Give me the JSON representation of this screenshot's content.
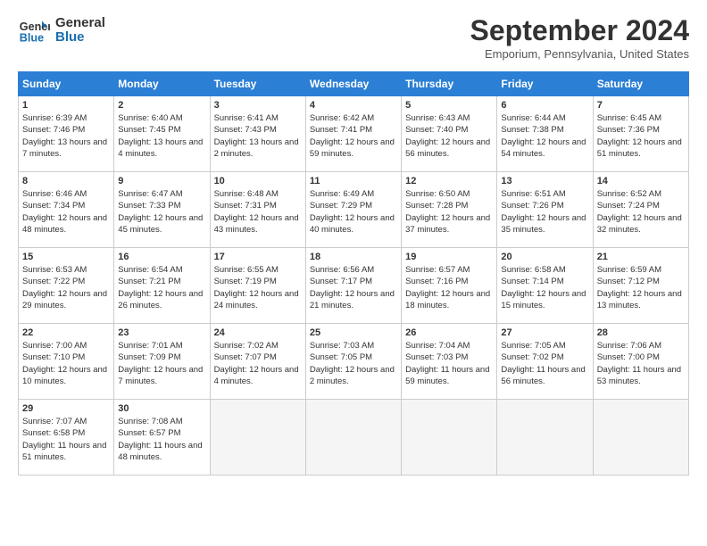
{
  "logo": {
    "line1": "General",
    "line2": "Blue"
  },
  "title": "September 2024",
  "location": "Emporium, Pennsylvania, United States",
  "headers": [
    "Sunday",
    "Monday",
    "Tuesday",
    "Wednesday",
    "Thursday",
    "Friday",
    "Saturday"
  ],
  "weeks": [
    [
      {
        "day": "1",
        "rise": "Sunrise: 6:39 AM",
        "set": "Sunset: 7:46 PM",
        "daylight": "Daylight: 13 hours and 7 minutes."
      },
      {
        "day": "2",
        "rise": "Sunrise: 6:40 AM",
        "set": "Sunset: 7:45 PM",
        "daylight": "Daylight: 13 hours and 4 minutes."
      },
      {
        "day": "3",
        "rise": "Sunrise: 6:41 AM",
        "set": "Sunset: 7:43 PM",
        "daylight": "Daylight: 13 hours and 2 minutes."
      },
      {
        "day": "4",
        "rise": "Sunrise: 6:42 AM",
        "set": "Sunset: 7:41 PM",
        "daylight": "Daylight: 12 hours and 59 minutes."
      },
      {
        "day": "5",
        "rise": "Sunrise: 6:43 AM",
        "set": "Sunset: 7:40 PM",
        "daylight": "Daylight: 12 hours and 56 minutes."
      },
      {
        "day": "6",
        "rise": "Sunrise: 6:44 AM",
        "set": "Sunset: 7:38 PM",
        "daylight": "Daylight: 12 hours and 54 minutes."
      },
      {
        "day": "7",
        "rise": "Sunrise: 6:45 AM",
        "set": "Sunset: 7:36 PM",
        "daylight": "Daylight: 12 hours and 51 minutes."
      }
    ],
    [
      {
        "day": "8",
        "rise": "Sunrise: 6:46 AM",
        "set": "Sunset: 7:34 PM",
        "daylight": "Daylight: 12 hours and 48 minutes."
      },
      {
        "day": "9",
        "rise": "Sunrise: 6:47 AM",
        "set": "Sunset: 7:33 PM",
        "daylight": "Daylight: 12 hours and 45 minutes."
      },
      {
        "day": "10",
        "rise": "Sunrise: 6:48 AM",
        "set": "Sunset: 7:31 PM",
        "daylight": "Daylight: 12 hours and 43 minutes."
      },
      {
        "day": "11",
        "rise": "Sunrise: 6:49 AM",
        "set": "Sunset: 7:29 PM",
        "daylight": "Daylight: 12 hours and 40 minutes."
      },
      {
        "day": "12",
        "rise": "Sunrise: 6:50 AM",
        "set": "Sunset: 7:28 PM",
        "daylight": "Daylight: 12 hours and 37 minutes."
      },
      {
        "day": "13",
        "rise": "Sunrise: 6:51 AM",
        "set": "Sunset: 7:26 PM",
        "daylight": "Daylight: 12 hours and 35 minutes."
      },
      {
        "day": "14",
        "rise": "Sunrise: 6:52 AM",
        "set": "Sunset: 7:24 PM",
        "daylight": "Daylight: 12 hours and 32 minutes."
      }
    ],
    [
      {
        "day": "15",
        "rise": "Sunrise: 6:53 AM",
        "set": "Sunset: 7:22 PM",
        "daylight": "Daylight: 12 hours and 29 minutes."
      },
      {
        "day": "16",
        "rise": "Sunrise: 6:54 AM",
        "set": "Sunset: 7:21 PM",
        "daylight": "Daylight: 12 hours and 26 minutes."
      },
      {
        "day": "17",
        "rise": "Sunrise: 6:55 AM",
        "set": "Sunset: 7:19 PM",
        "daylight": "Daylight: 12 hours and 24 minutes."
      },
      {
        "day": "18",
        "rise": "Sunrise: 6:56 AM",
        "set": "Sunset: 7:17 PM",
        "daylight": "Daylight: 12 hours and 21 minutes."
      },
      {
        "day": "19",
        "rise": "Sunrise: 6:57 AM",
        "set": "Sunset: 7:16 PM",
        "daylight": "Daylight: 12 hours and 18 minutes."
      },
      {
        "day": "20",
        "rise": "Sunrise: 6:58 AM",
        "set": "Sunset: 7:14 PM",
        "daylight": "Daylight: 12 hours and 15 minutes."
      },
      {
        "day": "21",
        "rise": "Sunrise: 6:59 AM",
        "set": "Sunset: 7:12 PM",
        "daylight": "Daylight: 12 hours and 13 minutes."
      }
    ],
    [
      {
        "day": "22",
        "rise": "Sunrise: 7:00 AM",
        "set": "Sunset: 7:10 PM",
        "daylight": "Daylight: 12 hours and 10 minutes."
      },
      {
        "day": "23",
        "rise": "Sunrise: 7:01 AM",
        "set": "Sunset: 7:09 PM",
        "daylight": "Daylight: 12 hours and 7 minutes."
      },
      {
        "day": "24",
        "rise": "Sunrise: 7:02 AM",
        "set": "Sunset: 7:07 PM",
        "daylight": "Daylight: 12 hours and 4 minutes."
      },
      {
        "day": "25",
        "rise": "Sunrise: 7:03 AM",
        "set": "Sunset: 7:05 PM",
        "daylight": "Daylight: 12 hours and 2 minutes."
      },
      {
        "day": "26",
        "rise": "Sunrise: 7:04 AM",
        "set": "Sunset: 7:03 PM",
        "daylight": "Daylight: 11 hours and 59 minutes."
      },
      {
        "day": "27",
        "rise": "Sunrise: 7:05 AM",
        "set": "Sunset: 7:02 PM",
        "daylight": "Daylight: 11 hours and 56 minutes."
      },
      {
        "day": "28",
        "rise": "Sunrise: 7:06 AM",
        "set": "Sunset: 7:00 PM",
        "daylight": "Daylight: 11 hours and 53 minutes."
      }
    ],
    [
      {
        "day": "29",
        "rise": "Sunrise: 7:07 AM",
        "set": "Sunset: 6:58 PM",
        "daylight": "Daylight: 11 hours and 51 minutes."
      },
      {
        "day": "30",
        "rise": "Sunrise: 7:08 AM",
        "set": "Sunset: 6:57 PM",
        "daylight": "Daylight: 11 hours and 48 minutes."
      },
      null,
      null,
      null,
      null,
      null
    ]
  ]
}
